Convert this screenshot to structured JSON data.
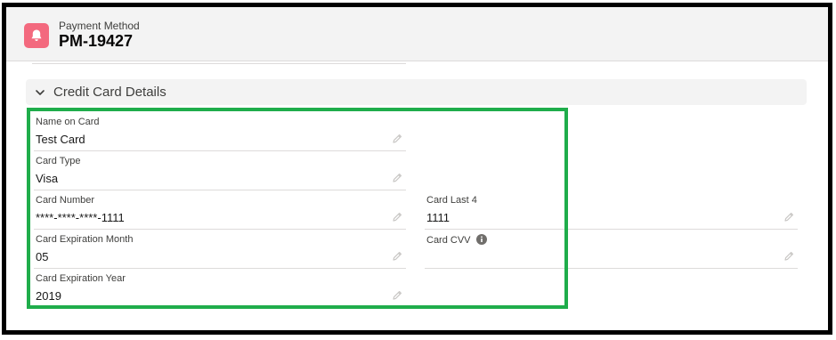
{
  "header": {
    "object_type": "Payment Method",
    "record_name": "PM-19427",
    "icon": "bell-icon",
    "icon_color": "#f3697e"
  },
  "section": {
    "title": "Credit Card Details",
    "icon": "chevron-down-icon"
  },
  "fields": {
    "name_on_card": {
      "label": "Name on Card",
      "value": "Test Card"
    },
    "card_type": {
      "label": "Card Type",
      "value": "Visa"
    },
    "card_number": {
      "label": "Card Number",
      "value": "****-****-****-1111"
    },
    "card_expiration_month": {
      "label": "Card Expiration Month",
      "value": "05"
    },
    "card_expiration_year": {
      "label": "Card Expiration Year",
      "value": "2019"
    },
    "card_last_4": {
      "label": "Card Last 4",
      "value": "1111"
    },
    "card_cvv": {
      "label": "Card CVV",
      "value": "",
      "icon": "info-icon"
    }
  },
  "colors": {
    "highlight": "#1fad4b",
    "frame": "#000000"
  }
}
